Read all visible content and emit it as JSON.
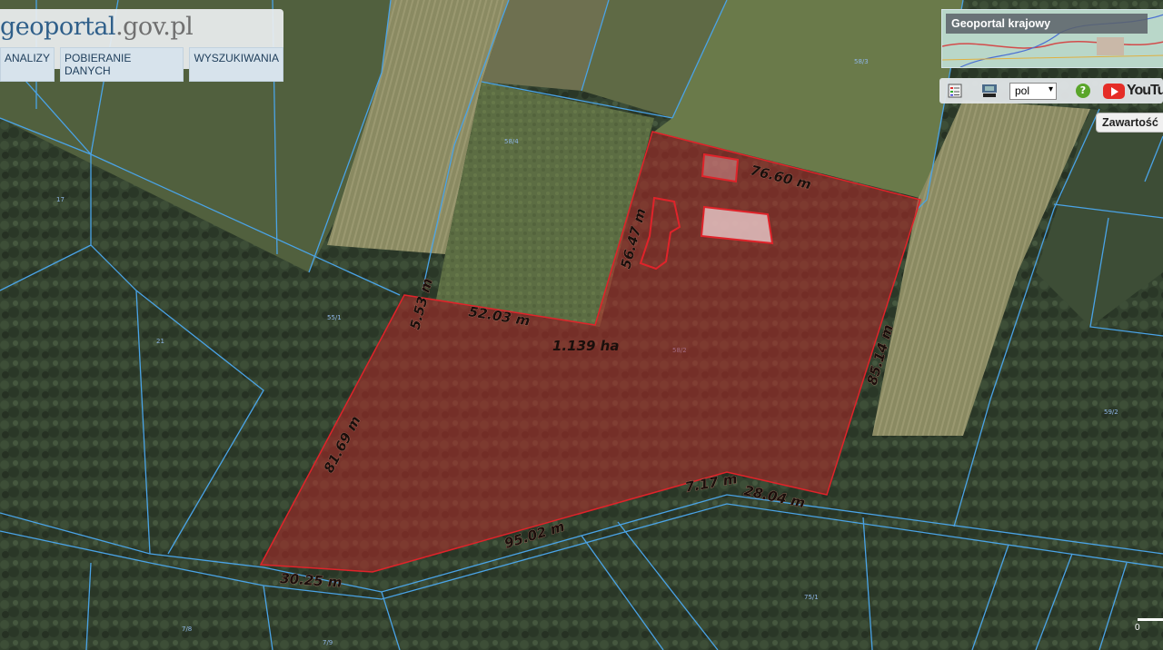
{
  "logo": {
    "part1": "geo",
    "part2": "portal",
    "part3": ".gov.pl"
  },
  "menu": [
    {
      "label": "ANALIZY"
    },
    {
      "label": "POBIERANIE DANYCH"
    },
    {
      "label": "WYSZUKIWANIA"
    }
  ],
  "geoportal_krajowy": {
    "title": "Geoportal krajowy"
  },
  "toolbar": {
    "language": "pol",
    "help": "?",
    "youtube_label": "YouTube",
    "icons": [
      "legend-icon",
      "wms-icon",
      "help-icon",
      "youtube-icon"
    ]
  },
  "contents_button": "Zawartość",
  "measurements": {
    "top_edge": "76.60 m",
    "inner_vertical": "56.47 m",
    "inner_horizontal": "52.03 m",
    "small_edge": "5.53 m",
    "right_edge": "85.14 m",
    "left_edge": "81.69 m",
    "bottom_edge": "95.02 m",
    "bottom_left": "30.25 m",
    "bottom_short": "7.17 m",
    "bottom_right": "28.04 m",
    "area": "1.139 ha"
  },
  "scale": {
    "label": "0"
  },
  "colors": {
    "parcel_line": "#4aa3e6",
    "selection_fill": "#b22a2a",
    "selection_stroke": "#e0232a",
    "forest": "#2f3d2c",
    "field": "#6b7a4c"
  }
}
